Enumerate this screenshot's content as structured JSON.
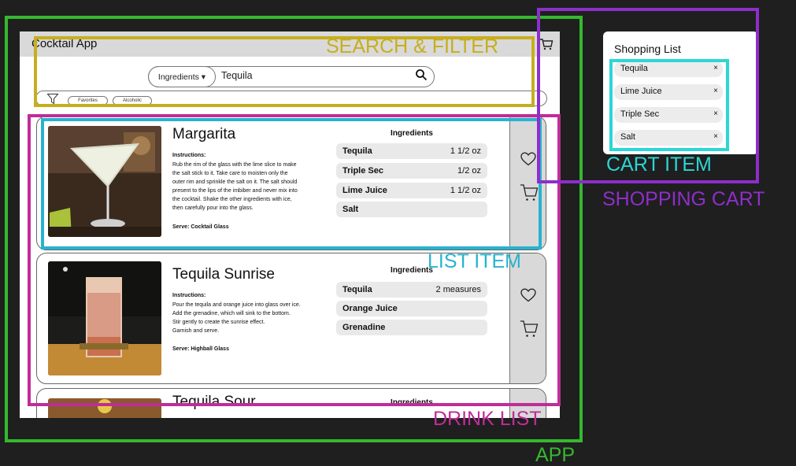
{
  "app": {
    "title": "Cocktail App",
    "cart_icon": "cart-icon"
  },
  "search": {
    "dropdown_label": "Ingredients ▾",
    "query": "Tequila",
    "search_icon": "search-icon"
  },
  "filters": {
    "filter_icon": "filter-icon",
    "chips": [
      "Favorites",
      "Alcoholic"
    ]
  },
  "drinks": [
    {
      "name": "Margarita",
      "instructions_label": "Instructions:",
      "instructions": [
        "Rub the rim of the glass with the lime slice to make",
        "the salt stick to it. Take care to moisten only the",
        "outer rim and sprinkle the salt on it. The salt should",
        "present to the lips of the imbiber and never mix into",
        "the cocktail. Shake the other ingredients with ice,",
        "then carefully pour into the glass."
      ],
      "serve": "Serve: Cocktail Glass",
      "ingredients_title": "Ingredients",
      "ingredients": [
        {
          "name": "Tequila",
          "amount": "1 1/2 oz"
        },
        {
          "name": "Triple Sec",
          "amount": "1/2 oz"
        },
        {
          "name": "Lime Juice",
          "amount": "1 1/2 oz"
        },
        {
          "name": "Salt",
          "amount": ""
        }
      ],
      "actions": [
        "heart-icon",
        "cart-icon"
      ]
    },
    {
      "name": "Tequila Sunrise",
      "instructions_label": "Instructions:",
      "instructions": [
        "Pour the tequila and orange juice into glass over ice.",
        "Add the grenadine, which will sink to the bottom.",
        "Stir gently to create the sunrise effect.",
        "Garnish and serve."
      ],
      "serve": "Serve: Highball Glass",
      "ingredients_title": "Ingredients",
      "ingredients": [
        {
          "name": "Tequila",
          "amount": "2 measures"
        },
        {
          "name": "Orange Juice",
          "amount": ""
        },
        {
          "name": "Grenadine",
          "amount": ""
        }
      ],
      "actions": [
        "heart-icon",
        "cart-icon"
      ]
    },
    {
      "name": "Tequila Sour",
      "ingredients_title": "Ingredients"
    }
  ],
  "shopping_list": {
    "title": "Shopping List",
    "items": [
      "Tequila",
      "Lime Juice",
      "Triple Sec",
      "Salt"
    ],
    "remove_glyph": "×"
  },
  "annotations": {
    "search_filter": {
      "label": "SEARCH & FILTER",
      "color": "#c7ae1e"
    },
    "list_item": {
      "label": "LIST ITEM",
      "color": "#27b3cf"
    },
    "drink_list": {
      "label": "DRINK LIST",
      "color": "#c02c98"
    },
    "app": {
      "label": "APP",
      "color": "#35b92e"
    },
    "cart_item": {
      "label": "CART ITEM",
      "color": "#2bd6d6"
    },
    "shopping_cart": {
      "label": "SHOPPING CART",
      "color": "#8e2ecb"
    }
  }
}
